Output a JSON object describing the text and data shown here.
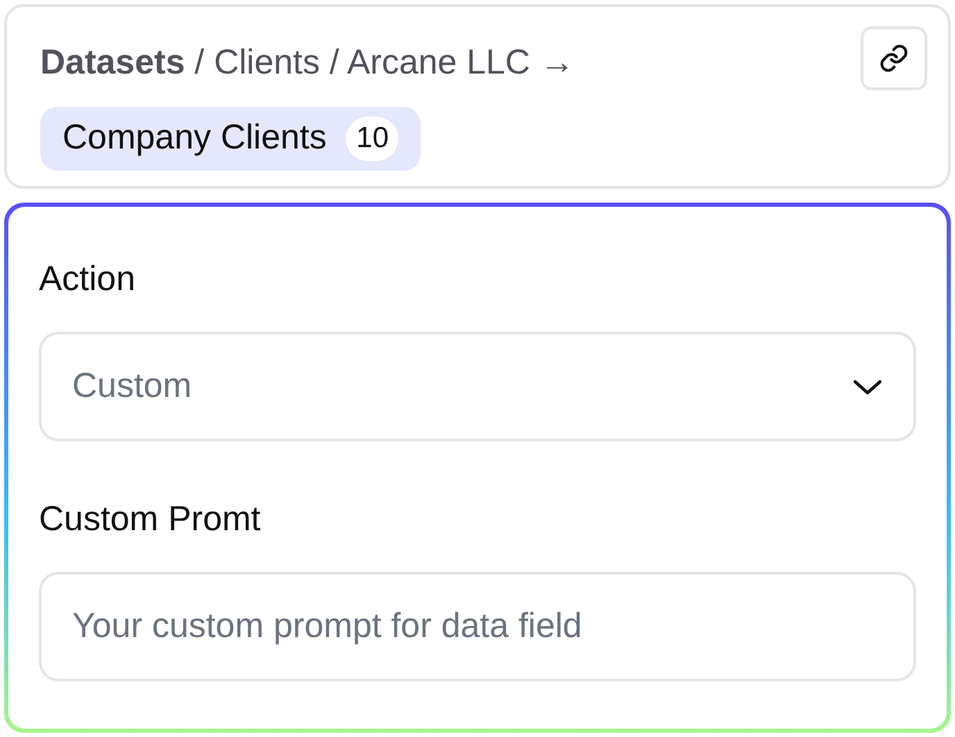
{
  "header": {
    "breadcrumb": "**Datasets** / Clients / Arcane LLC →",
    "chip": {
      "label": "Company Clients",
      "count": "10"
    }
  },
  "form": {
    "fields": [
      {
        "kind": "select",
        "label": "Action",
        "value": "Custom"
      },
      {
        "kind": "text",
        "label": "Custom Promt",
        "placeholder": "Your custom prompt for data field"
      }
    ]
  }
}
